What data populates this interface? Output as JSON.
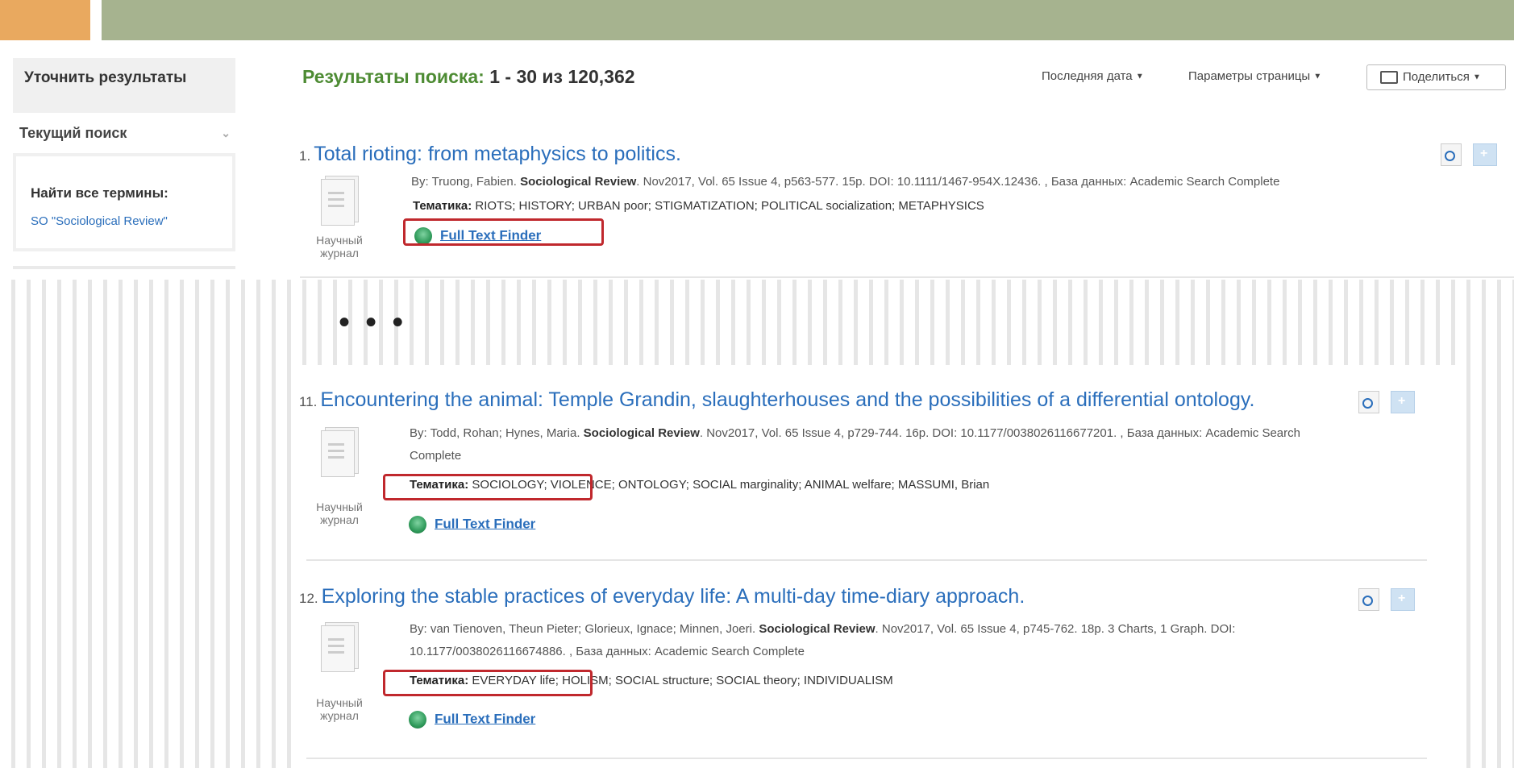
{
  "sidebar": {
    "refine_title": "Уточнить результаты",
    "current_search_label": "Текущий поиск",
    "find_all_terms_label": "Найти все термины:",
    "search_term": "SO \"Sociological Review\""
  },
  "header": {
    "results_label": "Результаты поиска:",
    "results_range": "1 - 30 из 120,362",
    "sort_label": "Последняя дата",
    "page_options_label": "Параметры страницы",
    "share_label": "Поделиться"
  },
  "ellipsis": "• • •",
  "results": [
    {
      "number": "1.",
      "title": "Total rioting: from metaphysics to politics.",
      "meta_line1_pre": "By: Truong, Fabien.",
      "journal": "Sociological Review",
      "meta_line1_post": ". Nov2017, Vol. 65 Issue 4, p563-577. 15p. DOI: 10.1111/1467-954X.12436. , База данных: Academic Search Complete",
      "meta_line2": "",
      "subjects_label": "Тематика:",
      "subjects": "RIOTS; HISTORY; URBAN poor; STIGMATIZATION; POLITICAL socialization; METAPHYSICS",
      "doc_type": "Научный журнал",
      "full_text": "Full Text Finder"
    },
    {
      "number": "11.",
      "title": "Encountering the animal: Temple Grandin, slaughterhouses and the possibilities of a differential ontology.",
      "meta_line1_pre": "By: Todd, Rohan; Hynes, Maria.",
      "journal": "Sociological Review",
      "meta_line1_post": ". Nov2017, Vol. 65 Issue 4, p729-744. 16p. DOI: 10.1177/0038026116677201. , База данных: Academic Search",
      "meta_line2": "Complete",
      "subjects_label": "Тематика:",
      "subjects": "SOCIOLOGY; VIOLENCE; ONTOLOGY; SOCIAL marginality; ANIMAL welfare; MASSUMI, Brian",
      "doc_type": "Научный журнал",
      "full_text": "Full Text Finder"
    },
    {
      "number": "12.",
      "title": "Exploring the stable practices of everyday life: A multi-day time-diary approach.",
      "meta_line1_pre": "By: van Tienoven, Theun Pieter; Glorieux, Ignace; Minnen, Joeri.",
      "journal": "Sociological Review",
      "meta_line1_post": ". Nov2017, Vol. 65 Issue 4, p745-762. 18p. 3 Charts, 1 Graph. DOI:",
      "meta_line2": "10.1177/0038026116674886. , База данных: Academic Search Complete",
      "subjects_label": "Тематика:",
      "subjects": "EVERYDAY life; HOLISM; SOCIAL structure; SOCIAL theory; INDIVIDUALISM",
      "doc_type": "Научный журнал",
      "full_text": "Full Text Finder"
    }
  ],
  "colors": {
    "banner_orange": "#e9a95f",
    "banner_green": "#a6b38f",
    "link_blue": "#2a6ebb",
    "results_green": "#4d8b33",
    "highlight_red": "#c0282d"
  }
}
